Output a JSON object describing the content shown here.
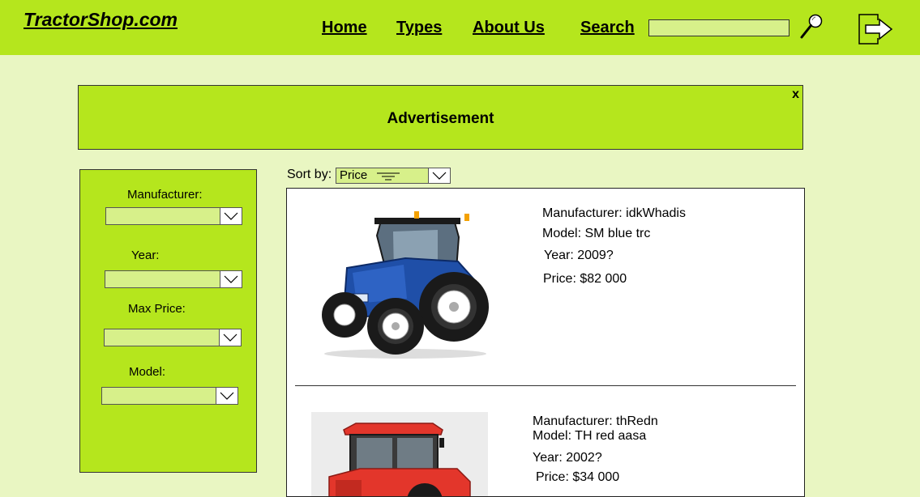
{
  "header": {
    "logo": "TractorShop.com",
    "nav": {
      "home": "Home",
      "types": "Types",
      "about": "About Us",
      "search": "Search"
    },
    "search": {
      "value": "",
      "placeholder": ""
    },
    "icons": {
      "search": "magnifier-icon",
      "exit": "exit-arrow-icon"
    }
  },
  "ad": {
    "text": "Advertisement",
    "close": "x"
  },
  "filters": {
    "manufacturer": {
      "label": "Manufacturer:",
      "value": ""
    },
    "year": {
      "label": "Year:",
      "value": ""
    },
    "max_price": {
      "label": "Max Price:",
      "value": ""
    },
    "model": {
      "label": "Model:",
      "value": ""
    }
  },
  "sort": {
    "label": "Sort  by:",
    "value": "Price"
  },
  "products": [
    {
      "manufacturer": "Manufacturer: idkWhadis",
      "model": "Model: SM blue trc",
      "year": "Year: 2009?",
      "price": "Price:  $82 000",
      "image": "blue-tractor-image"
    },
    {
      "manufacturer": "Manufacturer: thRedn",
      "model": "Model: TH red aasa",
      "year": "Year: 2002?",
      "price": "Price: $34 000",
      "image": "red-tractor-image"
    }
  ],
  "colors": {
    "brand_green": "#b5e61d",
    "page_background": "#e9f6c2",
    "input_green": "#d7f08a",
    "tractor_blue": "#1f4fa8",
    "tractor_red": "#e3362b"
  }
}
